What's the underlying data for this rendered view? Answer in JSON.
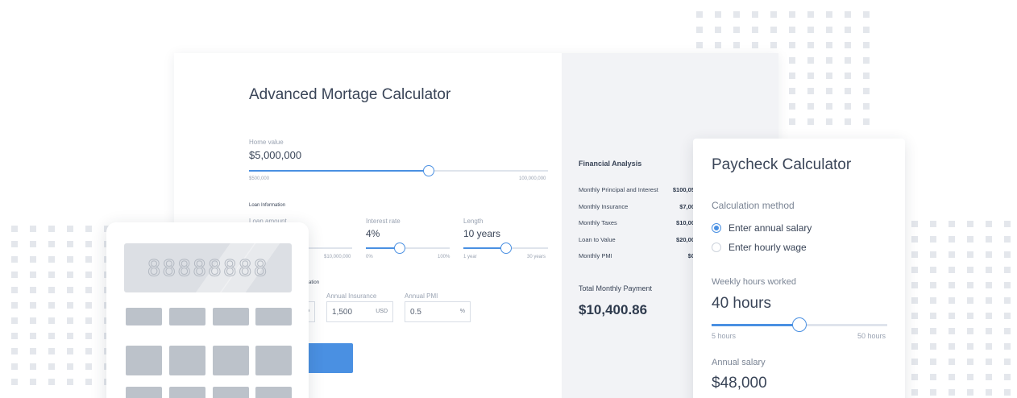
{
  "mortgage": {
    "title": "Advanced Mortage Calculator",
    "home_value": {
      "label": "Home value",
      "value": "$5,000,000",
      "min": "$500,000",
      "max": "100,000,000",
      "fraction": 0.6
    },
    "loan_info_heading": "Loan Information",
    "loan_amount": {
      "label": "Loan amount",
      "max": "$10,000,000"
    },
    "interest_rate": {
      "label": "Interest rate",
      "value": "4%",
      "min": "0%",
      "max": "100%",
      "fraction": 0.4
    },
    "length": {
      "label": "Length",
      "value": "10 years",
      "min": "1 year",
      "max": "30 years",
      "fraction": 0.5
    },
    "info_heading_partial": "formation",
    "annual_insurance": {
      "label": "Annual Insurance",
      "value": "1,500",
      "unit": "USD"
    },
    "annual_pmi": {
      "label": "Annual PMI",
      "value": "0.5",
      "unit": "%"
    },
    "hidden_unit": "D",
    "button_partial": "l"
  },
  "analysis": {
    "heading": "Financial Analysis",
    "rows": [
      {
        "label": "Monthly Principal and Interest",
        "value": "$100,05"
      },
      {
        "label": "Monthly Insurance",
        "value": "$7,00"
      },
      {
        "label": "Monthly Taxes",
        "value": "$10,00"
      },
      {
        "label": "Loan to Value",
        "value": "$20,00"
      },
      {
        "label": "Monthly PMI",
        "value": "$0"
      }
    ],
    "total_label": "Total Monthly Payment",
    "total_value": "$10,400.86"
  },
  "paycheck": {
    "title": "Paycheck Calculator",
    "method_label": "Calculation method",
    "options": [
      {
        "label": "Enter annual salary",
        "selected": true
      },
      {
        "label": "Enter hourly wage",
        "selected": false
      }
    ],
    "hours_label": "Weekly hours worked",
    "hours_value": "40 hours",
    "hours_min": "5 hours",
    "hours_max": "50 hours",
    "hours_fraction": 0.5,
    "salary_label": "Annual salary",
    "salary_value": "$48,000"
  },
  "calculator": {
    "display": "88888888"
  },
  "colors": {
    "accent": "#4a90e2",
    "panel": "#f2f3f6",
    "keys": "#bcc2ca",
    "dots": "#e4e7ec"
  },
  "icons": [
    "radio-selected-icon",
    "radio-unselected-icon",
    "slider-knob-icon"
  ]
}
